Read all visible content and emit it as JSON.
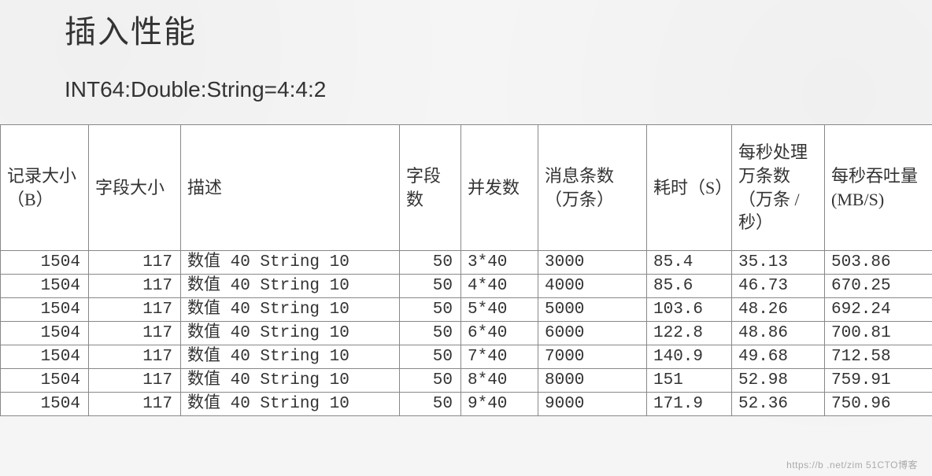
{
  "title": "插入性能",
  "subtitle": "INT64:Double:String=4:4:2",
  "watermark": "https://b   .net/zim  51CTO博客",
  "table": {
    "headers": [
      "记录大小（B）",
      "字段大小",
      "描述",
      "字段数",
      "并发数",
      "消息条数（万条）",
      "耗时（S）",
      "每秒处理万条数（万条 / 秒）",
      "每秒吞吐量(MB/S)"
    ],
    "rows": [
      {
        "record_size": "1504",
        "field_size": "117",
        "desc": "数值 40 String 10",
        "field_count": "50",
        "concurrency": "3*40",
        "msg_count": "3000",
        "elapsed": "85.4",
        "per_sec_wan": "35.13",
        "throughput": "503.86"
      },
      {
        "record_size": "1504",
        "field_size": "117",
        "desc": "数值 40 String 10",
        "field_count": "50",
        "concurrency": "4*40",
        "msg_count": "4000",
        "elapsed": "85.6",
        "per_sec_wan": "46.73",
        "throughput": "670.25"
      },
      {
        "record_size": "1504",
        "field_size": "117",
        "desc": "数值 40 String 10",
        "field_count": "50",
        "concurrency": "5*40",
        "msg_count": "5000",
        "elapsed": "103.6",
        "per_sec_wan": "48.26",
        "throughput": "692.24"
      },
      {
        "record_size": "1504",
        "field_size": "117",
        "desc": "数值 40 String 10",
        "field_count": "50",
        "concurrency": "6*40",
        "msg_count": "6000",
        "elapsed": "122.8",
        "per_sec_wan": "48.86",
        "throughput": "700.81"
      },
      {
        "record_size": "1504",
        "field_size": "117",
        "desc": "数值 40 String 10",
        "field_count": "50",
        "concurrency": "7*40",
        "msg_count": "7000",
        "elapsed": "140.9",
        "per_sec_wan": "49.68",
        "throughput": "712.58"
      },
      {
        "record_size": "1504",
        "field_size": "117",
        "desc": "数值 40 String 10",
        "field_count": "50",
        "concurrency": "8*40",
        "msg_count": "8000",
        "elapsed": "151",
        "per_sec_wan": "52.98",
        "throughput": "759.91"
      },
      {
        "record_size": "1504",
        "field_size": "117",
        "desc": "数值 40 String 10",
        "field_count": "50",
        "concurrency": "9*40",
        "msg_count": "9000",
        "elapsed": "171.9",
        "per_sec_wan": "52.36",
        "throughput": "750.96"
      }
    ]
  },
  "chart_data": {
    "type": "table",
    "title": "插入性能",
    "subtitle": "INT64:Double:String=4:4:2",
    "columns": [
      "记录大小（B）",
      "字段大小",
      "描述",
      "字段数",
      "并发数",
      "消息条数（万条）",
      "耗时（S）",
      "每秒处理万条数（万条/秒）",
      "每秒吞吐量(MB/S)"
    ],
    "rows": [
      [
        1504,
        117,
        "数值 40 String 10",
        50,
        "3*40",
        3000,
        85.4,
        35.13,
        503.86
      ],
      [
        1504,
        117,
        "数值 40 String 10",
        50,
        "4*40",
        4000,
        85.6,
        46.73,
        670.25
      ],
      [
        1504,
        117,
        "数值 40 String 10",
        50,
        "5*40",
        5000,
        103.6,
        48.26,
        692.24
      ],
      [
        1504,
        117,
        "数值 40 String 10",
        50,
        "6*40",
        6000,
        122.8,
        48.86,
        700.81
      ],
      [
        1504,
        117,
        "数值 40 String 10",
        50,
        "7*40",
        7000,
        140.9,
        49.68,
        712.58
      ],
      [
        1504,
        117,
        "数值 40 String 10",
        50,
        "8*40",
        8000,
        151,
        52.98,
        759.91
      ],
      [
        1504,
        117,
        "数值 40 String 10",
        50,
        "9*40",
        9000,
        171.9,
        52.36,
        750.96
      ]
    ]
  }
}
